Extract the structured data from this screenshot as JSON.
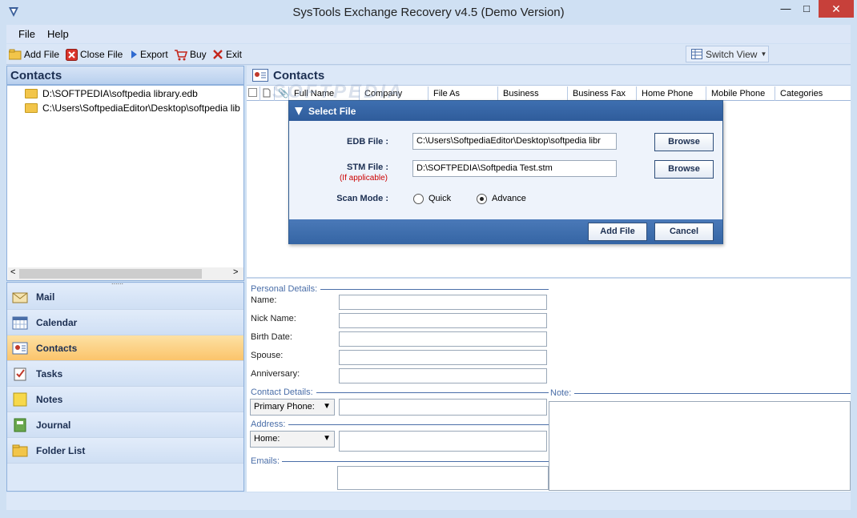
{
  "window": {
    "title": "SysTools Exchange Recovery v4.5 (Demo Version)",
    "min_glyph": "—",
    "max_glyph": "□",
    "close_glyph": "✕"
  },
  "menu": {
    "file": "File",
    "help": "Help"
  },
  "toolbar": {
    "add_file": "Add File",
    "close_file": "Close File",
    "export": "Export",
    "buy": "Buy",
    "exit": "Exit",
    "switch_view": "Switch View"
  },
  "left_panel": {
    "title": "Contacts",
    "tree": [
      "D:\\SOFTPEDIA\\softpedia library.edb",
      "C:\\Users\\SoftpediaEditor\\Desktop\\softpedia lib"
    ],
    "grip": "......",
    "scroll_left": "<",
    "scroll_right": ">"
  },
  "nav": [
    "Mail",
    "Calendar",
    "Contacts",
    "Tasks",
    "Notes",
    "Journal",
    "Folder List"
  ],
  "right_panel": {
    "title": "Contacts",
    "columns": [
      "Full Name",
      "Company",
      "File As",
      "Business",
      "Business Fax",
      "Home Phone",
      "Mobile Phone",
      "Categories"
    ]
  },
  "details": {
    "personal_section": "Personal Details:",
    "name": "Name:",
    "nick": "Nick Name:",
    "birth": "Birth Date:",
    "spouse": "Spouse:",
    "anniversary": "Anniversary:",
    "contact_section": "Contact Details:",
    "phone_select": "Primary Phone:",
    "address_section": "Address:",
    "address_select": "Home:",
    "emails_section": "Emails:",
    "note_section": "Note:"
  },
  "dialog": {
    "title": "Select File",
    "edb_label": "EDB File :",
    "edb_value": "C:\\Users\\SoftpediaEditor\\Desktop\\softpedia libr",
    "stm_label": "STM File :",
    "stm_hint": "(If applicable)",
    "stm_value": "D:\\SOFTPEDIA\\Softpedia Test.stm",
    "browse": "Browse",
    "scan_label": "Scan Mode :",
    "quick": "Quick",
    "advance": "Advance",
    "scan_selected": "Advance",
    "add_file": "Add File",
    "cancel": "Cancel"
  },
  "watermark": "SOFTPEDIA"
}
